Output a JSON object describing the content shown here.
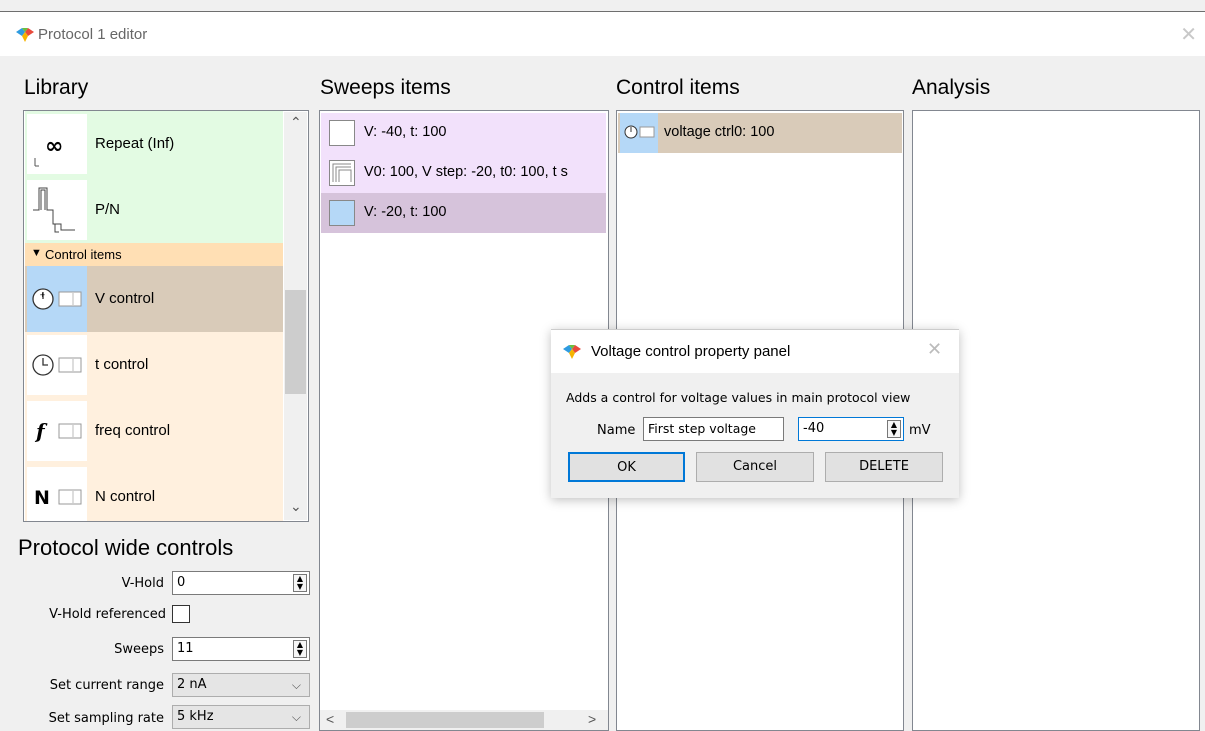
{
  "window": {
    "title": "Protocol 1 editor",
    "close_icon": "close-icon"
  },
  "sections": {
    "library": "Library",
    "sweeps": "Sweeps items",
    "control": "Control items",
    "analysis": "Analysis",
    "protocol_wide": "Protocol wide controls"
  },
  "library": {
    "items": [
      {
        "label": "Repeat (Inf)",
        "icon": "infinity-icon"
      },
      {
        "label": "P/N",
        "icon": "pn-waveform-icon"
      }
    ],
    "group_header": "Control items",
    "controls": [
      {
        "label": "V control",
        "icon": "voltage-gauge-icon"
      },
      {
        "label": "t control",
        "icon": "clock-icon"
      },
      {
        "label": "freq control",
        "icon": "function-icon"
      },
      {
        "label": "N control",
        "icon": "n-letter-icon"
      }
    ]
  },
  "protocol_wide": {
    "vhold_label": "V-Hold",
    "vhold_value": "0",
    "vhold_ref_label": "V-Hold referenced",
    "sweeps_label": "Sweeps",
    "sweeps_value": "11",
    "current_range_label": "Set current range",
    "current_range_value": "2 nA",
    "sampling_rate_label": "Set sampling rate",
    "sampling_rate_value": "5 kHz"
  },
  "sweeps": {
    "items": [
      {
        "label": "V: -40, t: 100"
      },
      {
        "label": "V0: 100, V step: -20, t0: 100, t s"
      },
      {
        "label": "V: -20, t: 100"
      }
    ]
  },
  "control_items": {
    "items": [
      {
        "label": "voltage ctrl0: 100"
      }
    ]
  },
  "dialog": {
    "title": "Voltage control property panel",
    "description": "Adds a control for voltage values in main protocol view",
    "name_label": "Name",
    "name_value": "First step voltage",
    "value": "-40",
    "unit": "mV",
    "ok": "OK",
    "cancel": "Cancel",
    "delete": "DELETE"
  },
  "colors": {
    "library_green": "#e3fbe3",
    "control_peach": "#fff0de",
    "control_selected": "#d9cbb9",
    "group_header": "#ffdfb4",
    "sweep_purple": "#f2e1fb",
    "sweep_selected": "#d6c3db",
    "icon_blue": "#b5d8f7"
  }
}
